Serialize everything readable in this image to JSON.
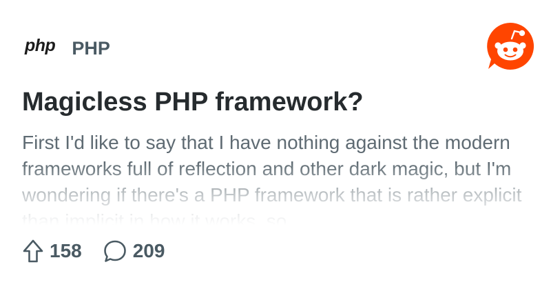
{
  "subreddit": {
    "logo_text": "php",
    "name": "PHP"
  },
  "brand": {
    "logo_icon": "reddit-snoo-icon",
    "accent": "#FF4500"
  },
  "post": {
    "title": "Magicless PHP framework?",
    "body": "First I'd like to say that I have nothing against the modern frameworks full of reflection and other dark magic, but I'm wondering if there's a PHP framework that is rather explicit than implicit in how it works, so",
    "upvotes": "158",
    "comments": "209"
  },
  "icons": {
    "upvote": "upvote-arrow-icon",
    "comment": "comment-bubble-icon"
  },
  "colors": {
    "title": "#262B2E",
    "body": "#5F6B73",
    "meta": "#4A5A63",
    "background": "#FFFFFF"
  }
}
